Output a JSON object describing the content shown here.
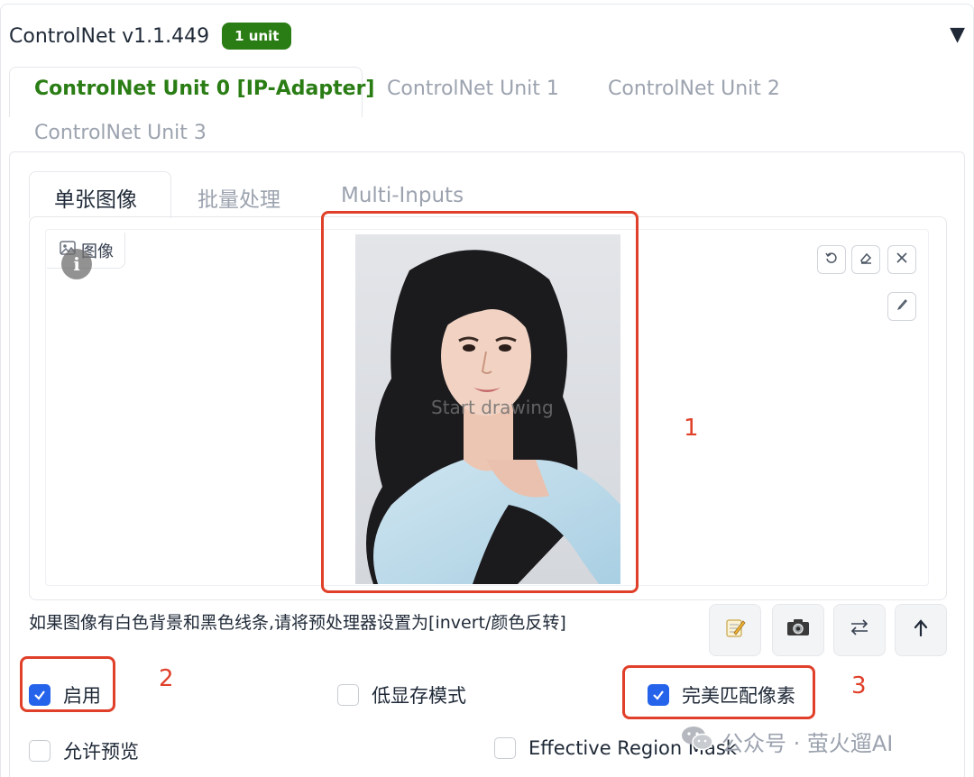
{
  "header": {
    "title": "ControlNet v1.1.449",
    "badge": "1 unit",
    "collapse_glyph": "▼"
  },
  "unit_tabs": [
    {
      "label": "ControlNet Unit 0 [IP-Adapter]",
      "active": true
    },
    {
      "label": "ControlNet Unit 1",
      "active": false
    },
    {
      "label": "ControlNet Unit 2",
      "active": false
    },
    {
      "label": "ControlNet Unit 3",
      "active": false
    }
  ],
  "image_tabs": [
    {
      "label": "单张图像",
      "active": true
    },
    {
      "label": "批量处理",
      "active": false
    },
    {
      "label": "Multi-Inputs",
      "active": false
    }
  ],
  "image_panel": {
    "label": "图像",
    "canvas_hint": "Start drawing",
    "tool_icons": [
      "undo-icon",
      "eraser-icon",
      "close-icon",
      "brush-icon"
    ]
  },
  "hint_text": "如果图像有白色背景和黑色线条,请将预处理器设置为[invert/颜色反转]",
  "action_buttons": [
    "edit-icon",
    "camera-icon",
    "swap-icon",
    "upload-icon"
  ],
  "checkboxes": {
    "enable": {
      "label": "启用",
      "checked": true
    },
    "low_vram": {
      "label": "低显存模式",
      "checked": false
    },
    "pixel_perfect": {
      "label": "完美匹配像素",
      "checked": true
    },
    "allow_preview": {
      "label": "允许预览",
      "checked": false
    },
    "effective_region_mask": {
      "label": "Effective Region Mask",
      "checked": false
    }
  },
  "annotations": [
    "1",
    "2",
    "3"
  ],
  "watermark": {
    "text": "公众号 · 萤火遛AI"
  },
  "colors": {
    "accent_green": "#2a7d14",
    "checkbox_blue": "#2563eb",
    "annotation_red": "#e0402a"
  }
}
